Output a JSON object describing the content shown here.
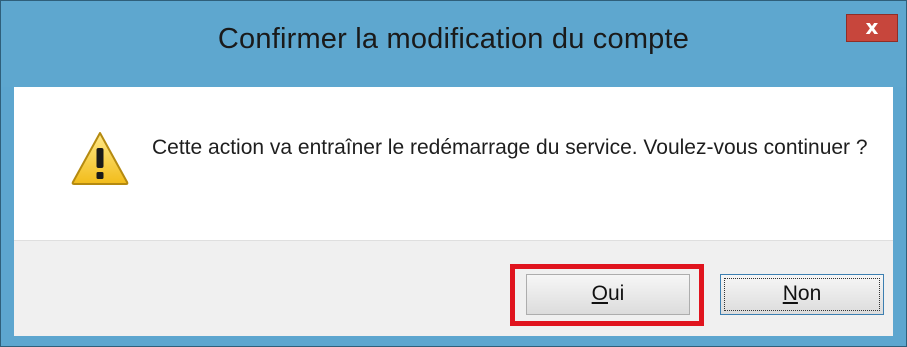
{
  "dialog": {
    "title": "Confirmer la modification du compte",
    "close_glyph": "x",
    "message": "Cette action va entraîner le redémarrage du service. Voulez-vous continuer ?",
    "icon": "warning-icon",
    "buttons": {
      "yes_first": "O",
      "yes_rest": "ui",
      "no_first": "N",
      "no_rest": "on"
    },
    "highlighted_button": "Oui",
    "colors": {
      "titlebar": "#5ea7cf",
      "close": "#c7463c",
      "highlight": "#e0141e"
    }
  }
}
